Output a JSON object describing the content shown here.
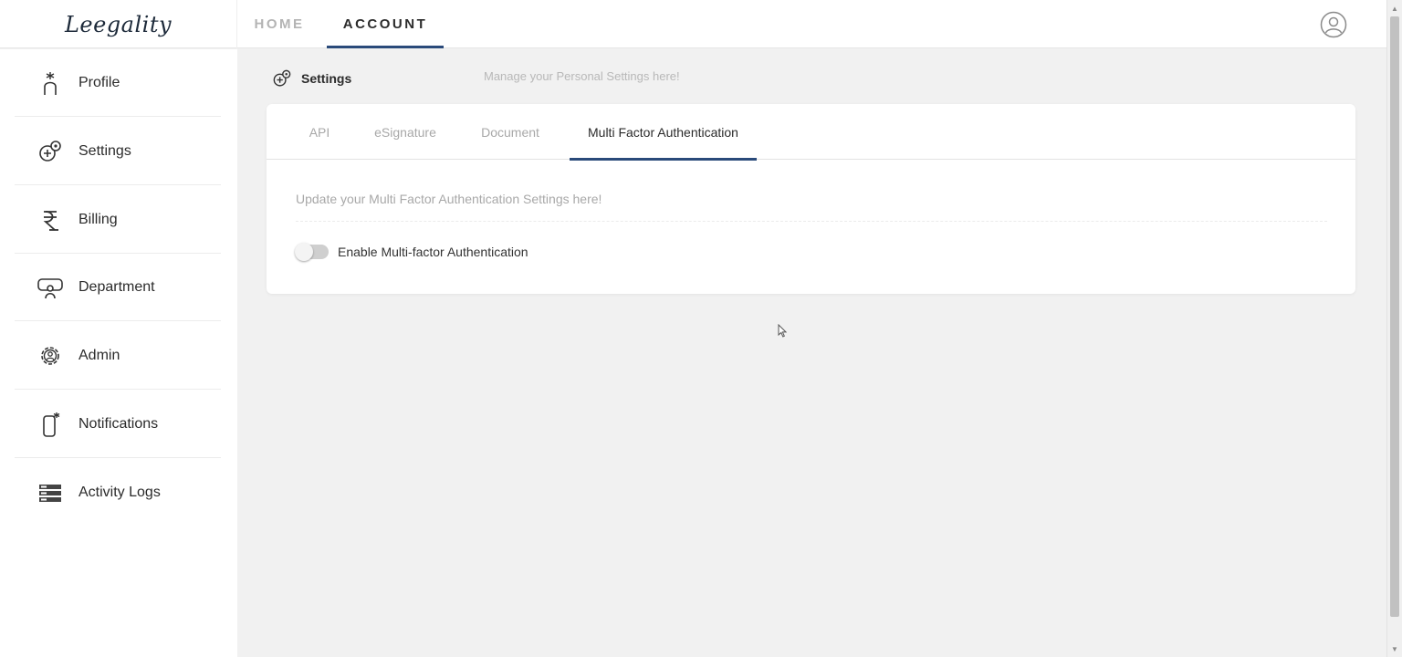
{
  "brand": {
    "logo_text": "Leegality"
  },
  "topnav": {
    "home_label": "HOME",
    "account_label": "ACCOUNT",
    "active": "ACCOUNT"
  },
  "sidebar": {
    "items": [
      {
        "label": "Profile",
        "icon": "profile-icon"
      },
      {
        "label": "Settings",
        "icon": "settings-icon"
      },
      {
        "label": "Billing",
        "icon": "rupee-icon"
      },
      {
        "label": "Department",
        "icon": "department-icon"
      },
      {
        "label": "Admin",
        "icon": "admin-gear-icon"
      },
      {
        "label": "Notifications",
        "icon": "notification-device-icon"
      },
      {
        "label": "Activity Logs",
        "icon": "activity-logs-icon"
      }
    ]
  },
  "main": {
    "section_title": "Settings",
    "section_subtitle": "Manage your Personal Settings here!",
    "tabs": [
      {
        "label": "API"
      },
      {
        "label": "eSignature"
      },
      {
        "label": "Document"
      },
      {
        "label": "Multi Factor Authentication"
      }
    ],
    "active_tab": "Multi Factor Authentication",
    "description": "Update your Multi Factor Authentication Settings here!",
    "toggle": {
      "label": "Enable Multi-factor Authentication",
      "enabled": false
    }
  },
  "colors": {
    "accent": "#2a4a7a",
    "muted_text": "#a8a8a8",
    "background": "#f1f1f1"
  }
}
